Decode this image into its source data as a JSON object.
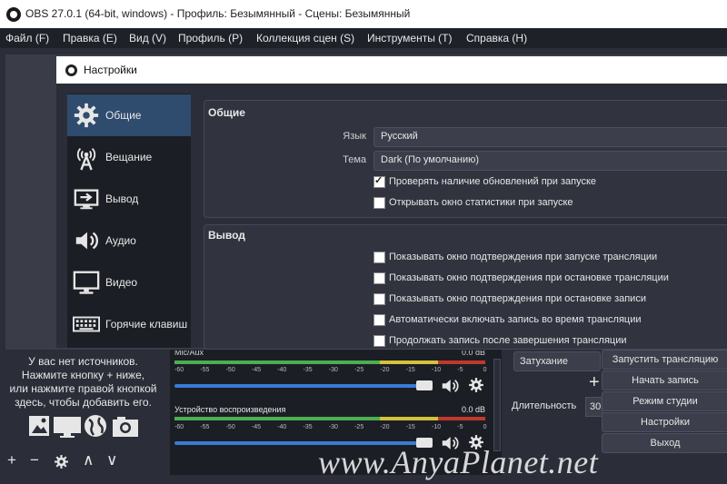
{
  "window": {
    "title": "OBS 27.0.1 (64-bit, windows) - Профиль: Безымянный - Сцены: Безымянный"
  },
  "menubar": [
    "Файл (F)",
    "Правка (E)",
    "Вид (V)",
    "Профиль (P)",
    "Коллекция сцен (S)",
    "Инструменты (T)",
    "Справка (H)"
  ],
  "dialog": {
    "title": "Настройки",
    "sidebar": [
      {
        "label": "Общие",
        "icon": "gear-icon",
        "active": true
      },
      {
        "label": "Вещание",
        "icon": "broadcast-antenna-icon",
        "active": false
      },
      {
        "label": "Вывод",
        "icon": "output-monitor-icon",
        "active": false
      },
      {
        "label": "Аудио",
        "icon": "speaker-icon",
        "active": false
      },
      {
        "label": "Видео",
        "icon": "monitor-icon",
        "active": false
      },
      {
        "label": "Горячие клавиш",
        "icon": "keyboard-icon",
        "active": false
      }
    ],
    "general": {
      "title": "Общие",
      "language_label": "Язык",
      "language_value": "Русский",
      "theme_label": "Тема",
      "theme_value": "Dark (По умолчанию)",
      "check_updates": {
        "label": "Проверять наличие обновлений при запуске",
        "checked": true
      },
      "open_stats": {
        "label": "Открывать окно статистики при запуске",
        "checked": false
      }
    },
    "output": {
      "title": "Вывод",
      "options": [
        {
          "label": "Показывать окно подтверждения при запуске трансляции",
          "checked": false
        },
        {
          "label": "Показывать окно подтверждения при остановке трансляции",
          "checked": false
        },
        {
          "label": "Показывать окно подтверждения при остановке записи",
          "checked": false
        },
        {
          "label": "Автоматически включать запись во время трансляции",
          "checked": false
        },
        {
          "label": "Продолжать запись после завершения трансляции",
          "checked": false
        }
      ]
    }
  },
  "sources": {
    "empty_text": [
      "У вас нет источников.",
      "Нажмите кнопку + ниже,",
      "или нажмите правой кнопкой",
      "здесь, чтобы добавить его."
    ],
    "toolbar": {
      "add": "+",
      "remove": "−",
      "up": "∧",
      "down": "∨"
    }
  },
  "mixer": {
    "track1": {
      "name": "Mic/Aux",
      "level": "0.0 dB"
    },
    "track2": {
      "name": "Устройство воспроизведения",
      "level": "0.0 dB"
    },
    "scale": [
      "-60",
      "-55",
      "-50",
      "-45",
      "-40",
      "-35",
      "-30",
      "-25",
      "-20",
      "-15",
      "-10",
      "-5",
      "0"
    ]
  },
  "transitions": {
    "fade_label": "Затухание",
    "plus": "+",
    "duration_label": "Длительность",
    "duration_value": "30"
  },
  "controls": {
    "start_stream": "Запустить трансляцию",
    "start_record": "Начать запись",
    "studio_mode": "Режим студии",
    "settings": "Настройки",
    "exit": "Выход"
  },
  "watermark": "www.AnyaPlanet.net",
  "colors": {
    "accent_selected": "#2f4b6e",
    "meter_green": "#4caf50",
    "meter_yellow": "#d4c23a",
    "meter_red": "#c0392b",
    "slider": "#3a7bd5"
  }
}
